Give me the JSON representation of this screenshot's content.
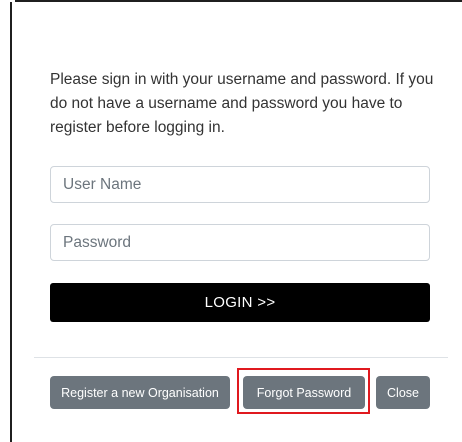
{
  "login": {
    "intro_text": "Please sign in with your username and password. If you do not have a username and password you have to register before logging in.",
    "username_placeholder": "User Name",
    "username_value": "",
    "password_placeholder": "Password",
    "password_value": "",
    "login_label": "LOGIN >>"
  },
  "footer": {
    "register_label": "Register a new Organisation",
    "forgot_label": "Forgot Password",
    "close_label": "Close"
  },
  "colors": {
    "login_button": "#000000",
    "secondary_button": "#6c757d",
    "highlight": "#e0191f"
  }
}
